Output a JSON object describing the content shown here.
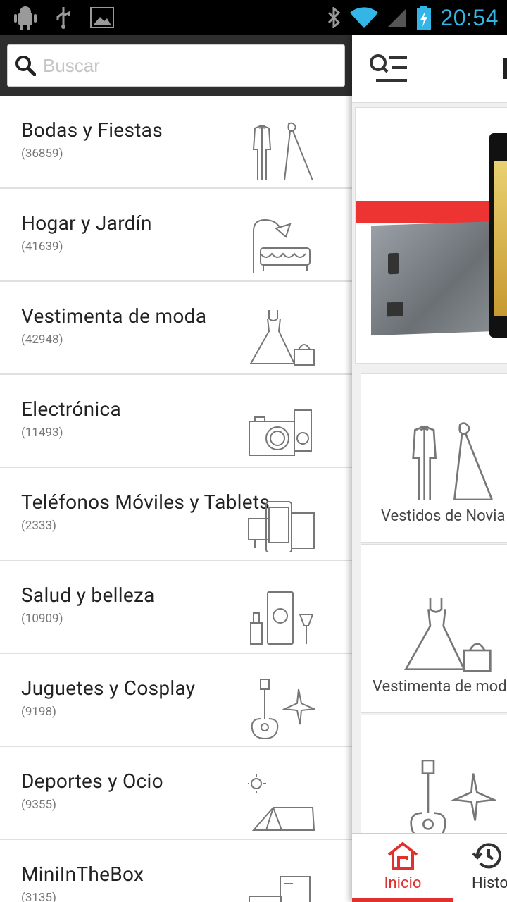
{
  "status_bar": {
    "time": "20:54",
    "icons": [
      "android-icon",
      "usb-icon",
      "image-icon",
      "bluetooth-icon",
      "wifi-icon",
      "signal-icon",
      "battery-charging-icon"
    ]
  },
  "search": {
    "placeholder": "Buscar"
  },
  "categories": [
    {
      "name": "Bodas y Fiestas",
      "count": "(36859)",
      "icon": "wedding-couple-icon"
    },
    {
      "name": "Hogar y Jardín",
      "count": "(41639)",
      "icon": "lamp-sofa-icon"
    },
    {
      "name": "Vestimenta de moda",
      "count": "(42948)",
      "icon": "dress-bag-icon"
    },
    {
      "name": "Electrónica",
      "count": "(11493)",
      "icon": "camera-player-icon"
    },
    {
      "name": "Teléfonos Móviles y Tablets",
      "count": "(2333)",
      "icon": "phone-tablet-icon"
    },
    {
      "name": "Salud y belleza",
      "count": "(10909)",
      "icon": "cosmetics-icon"
    },
    {
      "name": "Juguetes y Cosplay",
      "count": "(9198)",
      "icon": "guitar-plane-icon"
    },
    {
      "name": "Deportes y Ocio",
      "count": "(9355)",
      "icon": "tent-sun-icon"
    },
    {
      "name": "MiniInTheBox",
      "count": "(3135)",
      "icon": "box-icon"
    }
  ],
  "main": {
    "tiles": [
      {
        "label": "Vestidos de Novia",
        "icon": "wedding-couple-icon"
      },
      {
        "label": "Vestimenta de moda",
        "icon": "dress-bag-icon"
      },
      {
        "label": "",
        "icon": "guitar-plane-icon"
      }
    ],
    "bottom_nav": [
      {
        "label": "Inicio",
        "icon": "home-icon",
        "active": true
      },
      {
        "label": "Historial",
        "icon": "history-icon",
        "active": false
      }
    ],
    "colors": {
      "accent": "#e03030",
      "banner_red": "#ee3333"
    }
  }
}
